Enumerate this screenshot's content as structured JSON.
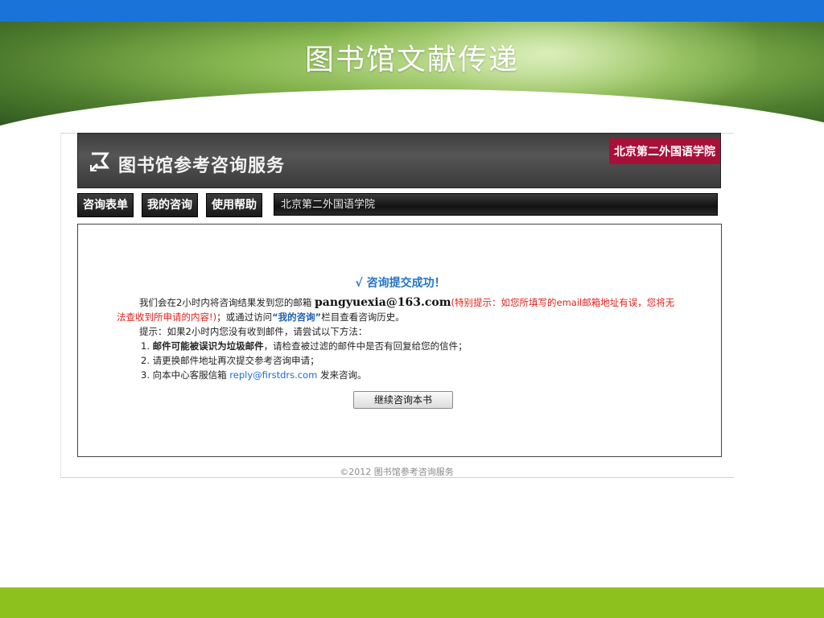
{
  "banner": {
    "title": "图书馆文献传递"
  },
  "header": {
    "service_title": "图书馆参考咨询服务",
    "school_badge": "北京第二外国语学院",
    "logo_icon": "book-arrow-icon"
  },
  "nav": {
    "tabs": [
      {
        "label": "咨询表单"
      },
      {
        "label": "我的咨询"
      },
      {
        "label": "使用帮助"
      }
    ],
    "institution": "北京第二外国语学院"
  },
  "content": {
    "success_text": "√ 咨询提交成功！",
    "line1_prefix": "我们会在2小时内将咨询结果发到您的邮箱",
    "email": "pangyuexia@163.com",
    "warning_a": "(特别提示：如您所填写的email邮箱地址有误，您将无",
    "warning_b": "法查收到所申请的内容!)",
    "line2_mid": "；或通过访问",
    "my_link": "“我的咨询”",
    "line2_tail": "栏目查看咨询历史。",
    "hint": "提示：如果2小时内您没有收到邮件，请尝试以下方法：",
    "item1_num": "1.",
    "item1_bold": "邮件可能被误识为垃圾邮件",
    "item1_rest": "，请检查被过滤的邮件中是否有回复给您的信件；",
    "item2": "2. 请更换邮件地址再次提交参考咨询申请；",
    "item3_prefix": "3. 向本中心客服信箱",
    "service_email": "reply@firstdrs.com",
    "item3_suffix": "发来咨询。",
    "continue_button": "继续咨询本书"
  },
  "footer": {
    "copyright": "©2012 图书馆参考咨询服务"
  },
  "colors": {
    "top_bar": "#1a73d8",
    "bottom_bar": "#8dc11e",
    "badge": "#a8103a",
    "success": "#2374c4",
    "warning": "#e0201c"
  }
}
